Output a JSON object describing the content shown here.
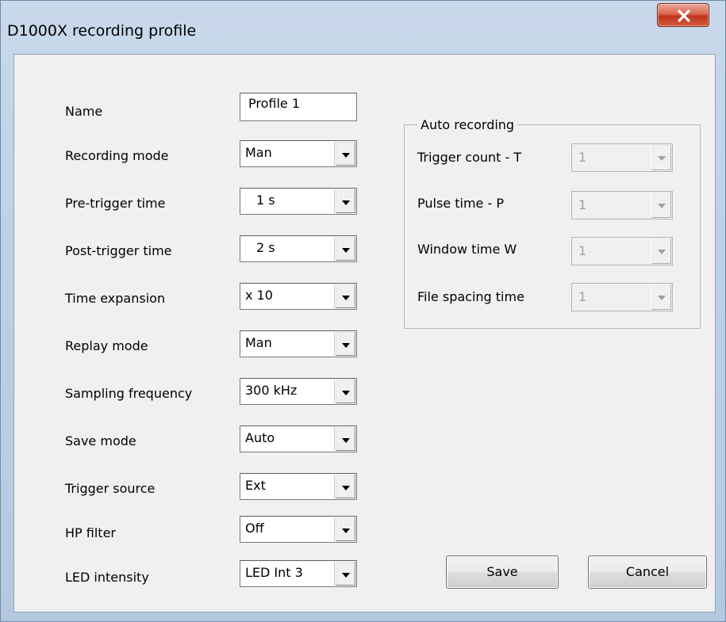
{
  "window": {
    "title": "D1000X recording profile",
    "close_label": "X"
  },
  "form": {
    "name": {
      "label": "Name",
      "value": "Profile 1"
    },
    "fields": [
      {
        "label": "Recording mode",
        "value": "Man"
      },
      {
        "label": "Pre-trigger time",
        "value": "1 s"
      },
      {
        "label": "Post-trigger time",
        "value": "2 s"
      },
      {
        "label": "Time expansion",
        "value": "x 10"
      },
      {
        "label": "Replay mode",
        "value": "Man"
      },
      {
        "label": "Sampling frequency",
        "value": "300 kHz"
      },
      {
        "label": "Save mode",
        "value": "Auto"
      },
      {
        "label": "Trigger source",
        "value": "Ext"
      },
      {
        "label": "HP filter",
        "value": "Off"
      },
      {
        "label": "LED intensity",
        "value": "LED Int 3"
      }
    ]
  },
  "auto_recording": {
    "title": "Auto recording",
    "fields": [
      {
        "label": "Trigger count - T",
        "value": "1"
      },
      {
        "label": "Pulse time - P",
        "value": "1"
      },
      {
        "label": "Window time W",
        "value": "1"
      },
      {
        "label": "File spacing time",
        "value": "1"
      }
    ]
  },
  "buttons": {
    "save": "Save",
    "cancel": "Cancel"
  },
  "icons": {
    "dropdown": "chevron-down-icon",
    "close": "close-icon"
  }
}
